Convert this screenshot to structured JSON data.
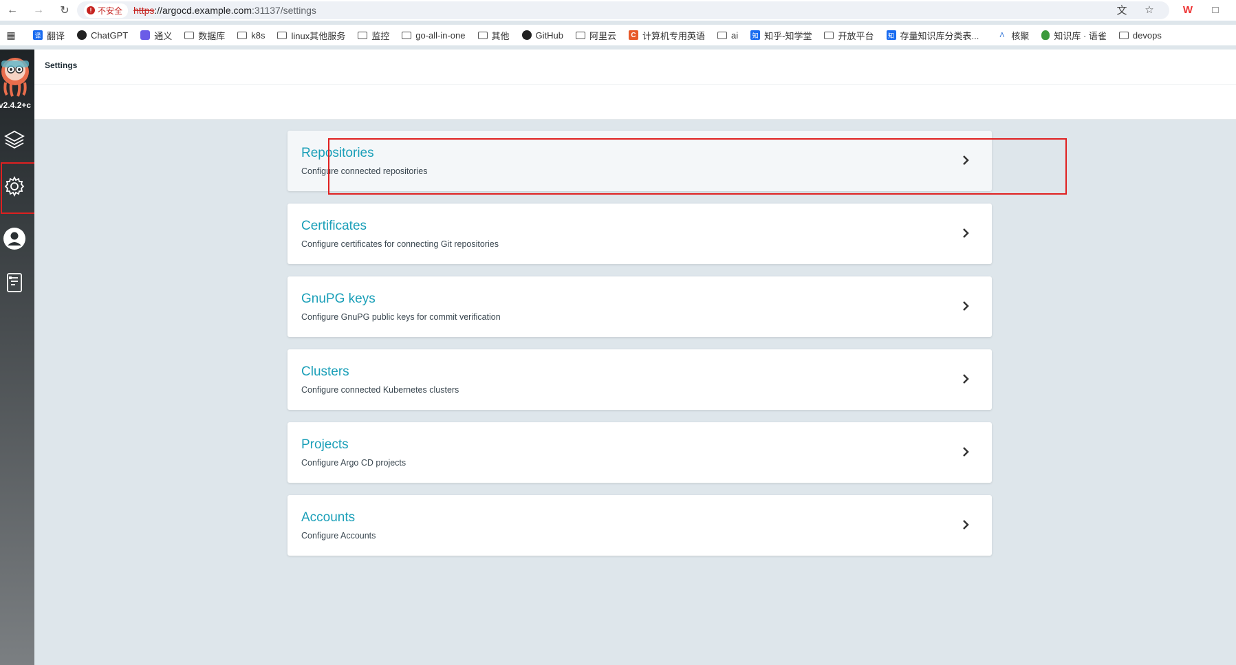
{
  "browser": {
    "insecure_label": "不安全",
    "url_scheme": "https",
    "url_host": "://argocd.example.com",
    "url_path": ":31137/settings"
  },
  "bookmarks": [
    {
      "label": "翻译",
      "icon": "translate-icon"
    },
    {
      "label": "ChatGPT",
      "icon": "chatgpt-icon"
    },
    {
      "label": "通义",
      "icon": "tongyi-icon"
    },
    {
      "label": "数据库",
      "icon": "folder-icon"
    },
    {
      "label": "k8s",
      "icon": "folder-icon"
    },
    {
      "label": "linux其他服务",
      "icon": "folder-icon"
    },
    {
      "label": "监控",
      "icon": "folder-icon"
    },
    {
      "label": "go-all-in-one",
      "icon": "folder-icon"
    },
    {
      "label": "其他",
      "icon": "folder-icon"
    },
    {
      "label": "GitHub",
      "icon": "github-icon"
    },
    {
      "label": "阿里云",
      "icon": "folder-icon"
    },
    {
      "label": "计算机专用英语",
      "icon": "c-icon"
    },
    {
      "label": "ai",
      "icon": "folder-icon"
    },
    {
      "label": "知乎-知学堂",
      "icon": "zhihu-icon"
    },
    {
      "label": "开放平台",
      "icon": "folder-icon"
    },
    {
      "label": "存量知识库分类表...",
      "icon": "zhihu-icon"
    },
    {
      "label": "核聚",
      "icon": "hejv-icon"
    },
    {
      "label": "知识库 · 语雀",
      "icon": "yuque-icon"
    },
    {
      "label": "devops",
      "icon": "folder-icon"
    }
  ],
  "app": {
    "version": "v2.4.2+c",
    "page_title": "Settings"
  },
  "settings": [
    {
      "title": "Repositories",
      "desc": "Configure connected repositories"
    },
    {
      "title": "Certificates",
      "desc": "Configure certificates for connecting Git repositories"
    },
    {
      "title": "GnuPG keys",
      "desc": "Configure GnuPG public keys for commit verification"
    },
    {
      "title": "Clusters",
      "desc": "Configure connected Kubernetes clusters"
    },
    {
      "title": "Projects",
      "desc": "Configure Argo CD projects"
    },
    {
      "title": "Accounts",
      "desc": "Configure Accounts"
    }
  ],
  "colors": {
    "accent": "#1a9fb8",
    "highlight": "#e02020",
    "background": "#dee6eb"
  }
}
